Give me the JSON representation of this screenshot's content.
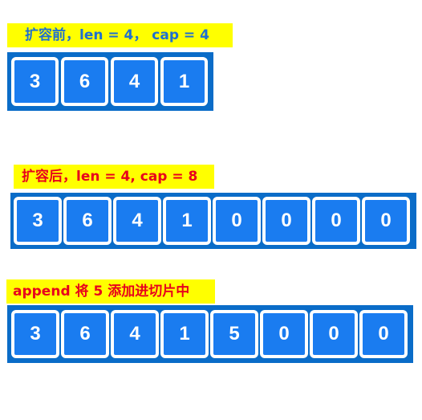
{
  "diagram": {
    "before": {
      "label": "扩容前，len = 4， cap = 4",
      "cells": [
        "3",
        "6",
        "4",
        "1"
      ]
    },
    "after": {
      "label": "扩容后，len = 4, cap = 8",
      "cells": [
        "3",
        "6",
        "4",
        "1",
        "0",
        "0",
        "0",
        "0"
      ]
    },
    "append": {
      "label": "append 将 5 添加进切片中",
      "cells": [
        "3",
        "6",
        "4",
        "1",
        "5",
        "0",
        "0",
        "0"
      ]
    }
  },
  "colors": {
    "label_background": "#ffff00",
    "label_blue_text": "#1e6fd0",
    "label_red_text": "#e8001c",
    "array_frame": "#0a6cc8",
    "cell_fill": "#1a7cf0",
    "cell_border": "#ffffff"
  }
}
